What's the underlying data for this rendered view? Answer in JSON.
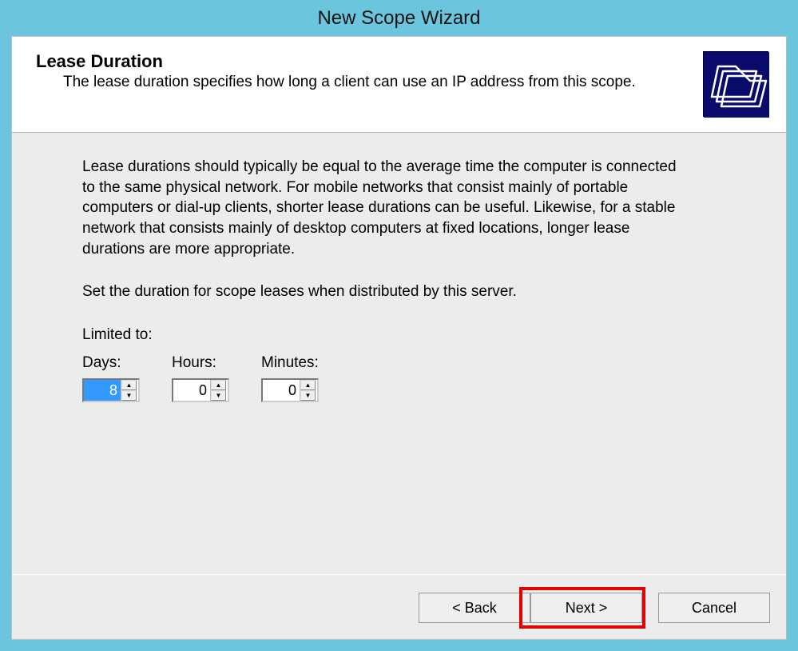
{
  "title": "New Scope Wizard",
  "header": {
    "heading": "Lease Duration",
    "subheading": "The lease duration specifies how long a client can use an IP address from this scope."
  },
  "body": {
    "para1": "Lease durations should typically be equal to the average time the computer is connected to the same physical network. For mobile networks that consist mainly of portable computers or dial-up clients, shorter lease durations can be useful. Likewise, for a stable network that consists mainly of desktop computers at fixed locations, longer lease durations are more appropriate.",
    "para2": "Set the duration for scope leases when distributed by this server.",
    "limited_to": "Limited to:",
    "days_label": "Days:",
    "hours_label": "Hours:",
    "minutes_label": "Minutes:",
    "days_value": "8",
    "hours_value": "0",
    "minutes_value": "0"
  },
  "footer": {
    "back": "< Back",
    "next": "Next >",
    "cancel": "Cancel"
  },
  "icon": "folder-stack-icon"
}
